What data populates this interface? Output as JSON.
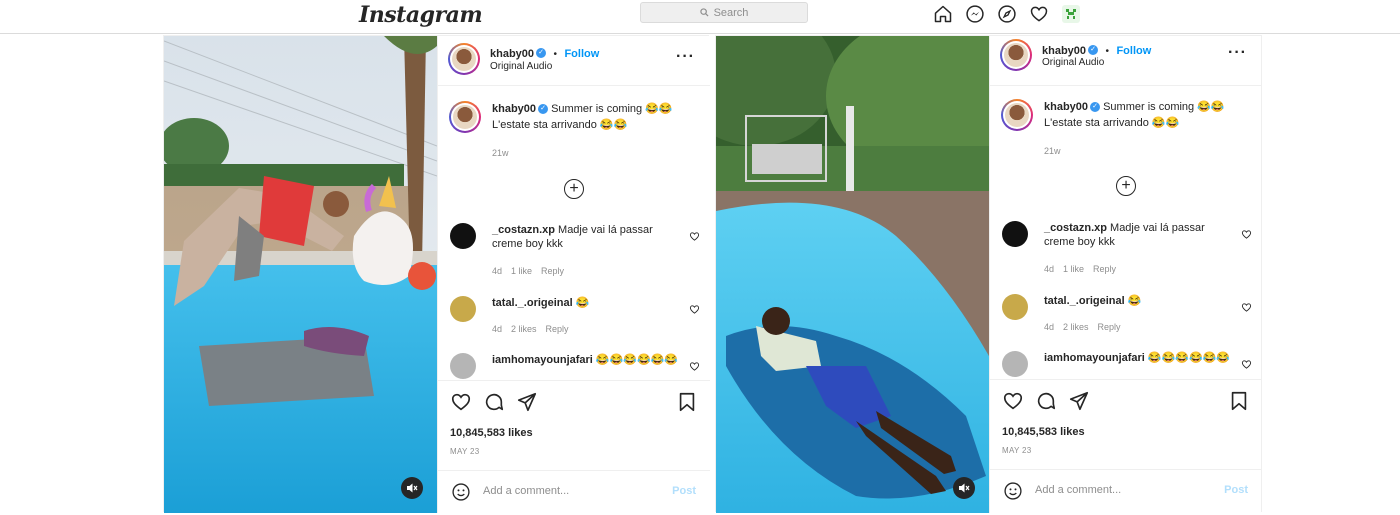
{
  "app": {
    "logo": "Instagram",
    "search_placeholder": "Search"
  },
  "nav": {
    "icons": [
      "home-icon",
      "messenger-icon",
      "explore-icon",
      "heart-icon",
      "profile-avatar"
    ]
  },
  "posts": [
    {
      "username": "khaby00",
      "follow": "Follow",
      "separator": "•",
      "audio": "Original Audio",
      "caption_user": "khaby00",
      "caption_line1": "Summer is coming 😂😂",
      "caption_line2": "L'estate sta arrivando 😂😂",
      "caption_time": "21w",
      "comments": [
        {
          "user": "_costazn.xp",
          "text": "Madje vai lá passar creme boy kkk",
          "time": "4d",
          "likes": "1 like",
          "reply": "Reply"
        },
        {
          "user": "tatal._.origeinal",
          "text": "😂",
          "time": "4d",
          "likes": "2 likes",
          "reply": "Reply"
        },
        {
          "user": "iamhomayounjafari",
          "text": "😂😂😂😂😂😂"
        }
      ],
      "likes": "10,845,583 likes",
      "date": "MAY 23",
      "add_comment": "Add a comment...",
      "post_button": "Post"
    },
    {
      "username": "khaby00",
      "follow": "Follow",
      "separator": "•",
      "audio": "Original Audio",
      "caption_user": "khaby00",
      "caption_line1": "Summer is coming 😂😂",
      "caption_line2": "L'estate sta arrivando 😂😂",
      "caption_time": "21w",
      "comments": [
        {
          "user": "_costazn.xp",
          "text": "Madje vai lá passar creme boy kkk",
          "time": "4d",
          "likes": "1 like",
          "reply": "Reply"
        },
        {
          "user": "tatal._.origeinal",
          "text": "😂",
          "time": "4d",
          "likes": "2 likes",
          "reply": "Reply"
        },
        {
          "user": "iamhomayounjafari",
          "text": "😂😂😂😂😂😂"
        }
      ],
      "likes": "10,845,583 likes",
      "date": "MAY 23",
      "add_comment": "Add a comment...",
      "post_button": "Post"
    }
  ],
  "colors": {
    "accent": "#0095f6",
    "border": "#dbdbdb",
    "muted": "#8e8e8e",
    "pool": "#2ab3e0"
  }
}
